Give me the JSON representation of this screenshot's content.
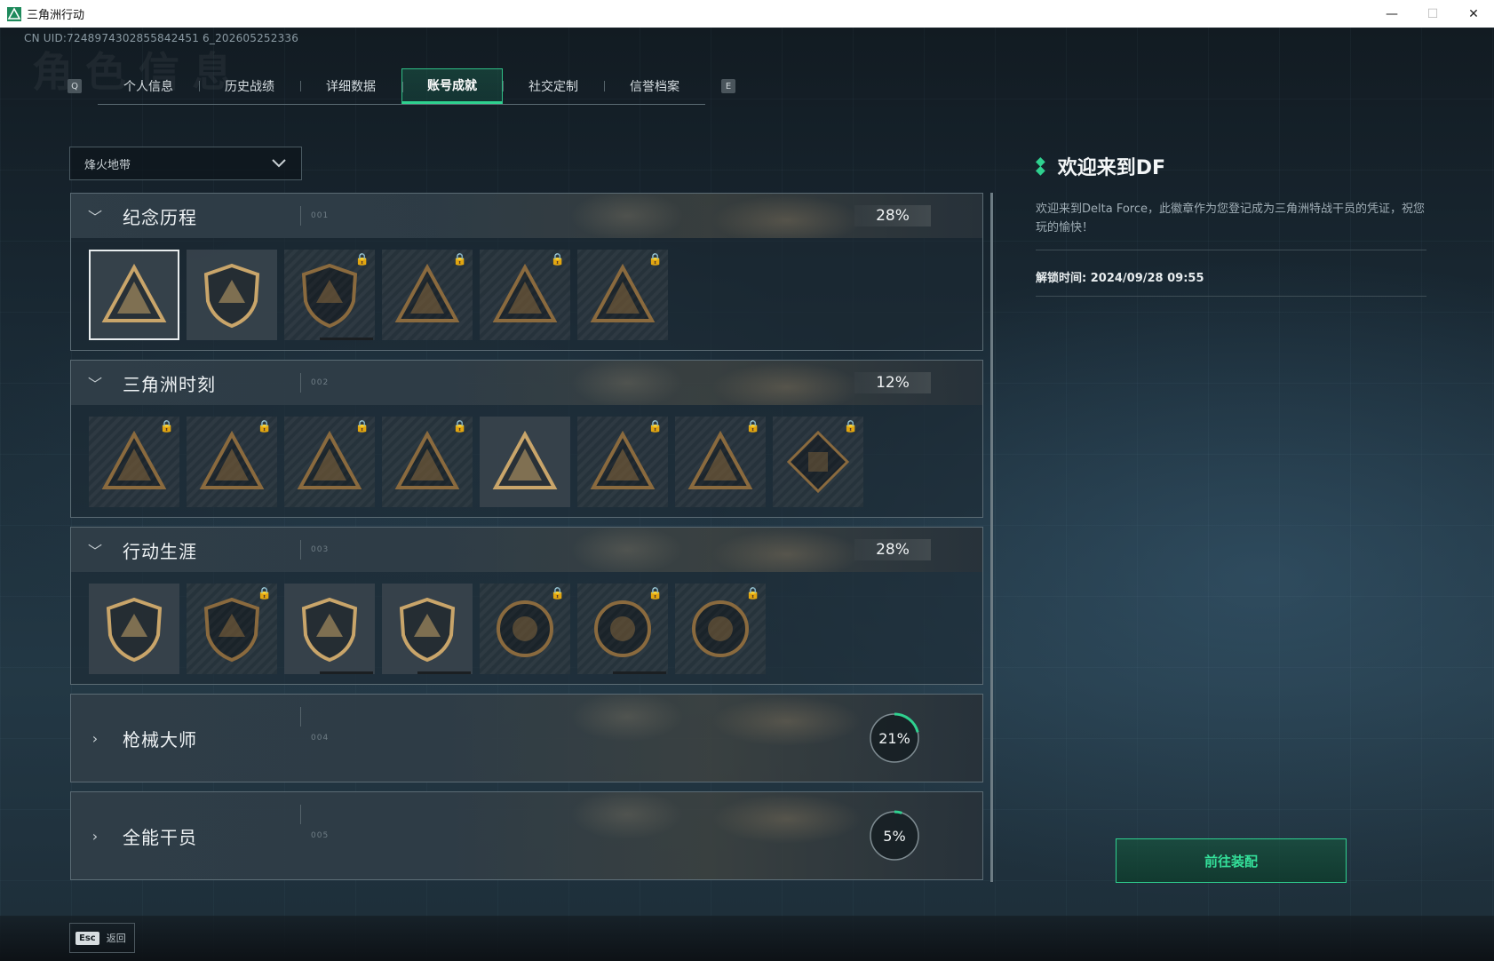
{
  "window": {
    "title": "三角洲行动",
    "minimize": "—",
    "maximize": "☐",
    "close": "✕"
  },
  "uid": "CN UID:7248974302855842451 6_202605252336",
  "watermark": "角色信息",
  "tabs": {
    "left_key": "Q",
    "right_key": "E",
    "items": [
      {
        "label": "个人信息",
        "active": false
      },
      {
        "label": "历史战绩",
        "active": false
      },
      {
        "label": "详细数据",
        "active": false
      },
      {
        "label": "账号成就",
        "active": true
      },
      {
        "label": "社交定制",
        "active": false
      },
      {
        "label": "信誉档案",
        "active": false
      }
    ]
  },
  "mode_select": {
    "value": "烽火地带"
  },
  "sections": [
    {
      "title": "纪念历程",
      "id_text": "001",
      "percent": "28%",
      "expanded": true,
      "badges": [
        {
          "icon": "delta-triangle-badge-icon",
          "locked": false,
          "selected": true
        },
        {
          "icon": "helicopter-badge-icon",
          "locked": false
        },
        {
          "icon": "shield-emblem-badge-icon",
          "locked": true,
          "progress": true
        },
        {
          "icon": "soldier-cross-badge-icon",
          "locked": true
        },
        {
          "icon": "hooded-figure-badge-icon",
          "locked": true
        },
        {
          "icon": "skull-swords-badge-icon",
          "locked": true
        }
      ]
    },
    {
      "title": "三角洲时刻",
      "id_text": "002",
      "percent": "12%",
      "expanded": true,
      "badges": [
        {
          "icon": "robot-triangle-badge-icon",
          "locked": true
        },
        {
          "icon": "operator-triangle-badge-icon",
          "locked": true
        },
        {
          "icon": "kneeling-soldier-badge-icon",
          "locked": true
        },
        {
          "icon": "lion-triangle-badge-icon",
          "locked": true
        },
        {
          "icon": "squad-triangle-badge-icon",
          "locked": false
        },
        {
          "icon": "wolf-triangle-badge-icon",
          "locked": true
        },
        {
          "icon": "dragon-triangle-badge-icon",
          "locked": true
        },
        {
          "icon": "cube-diamond-badge-icon",
          "locked": true
        }
      ]
    },
    {
      "title": "行动生涯",
      "id_text": "003",
      "percent": "28%",
      "expanded": true,
      "badges": [
        {
          "icon": "star-medal-badge-icon",
          "locked": false
        },
        {
          "icon": "chevron-shield-badge-icon",
          "locked": true
        },
        {
          "icon": "police-shield-badge-icon",
          "locked": false,
          "progress": true
        },
        {
          "icon": "gem-shield-badge-icon",
          "locked": false,
          "progress": true
        },
        {
          "icon": "shell-circle-badge-icon",
          "locked": true
        },
        {
          "icon": "skull-circle-badge-icon",
          "locked": true,
          "progress": true
        },
        {
          "icon": "eye-circle-badge-icon",
          "locked": true
        }
      ]
    },
    {
      "title": "枪械大师",
      "id_text": "004",
      "percent": "21%",
      "progress": 0.21,
      "expanded": false
    },
    {
      "title": "全能干员",
      "id_text": "005",
      "percent": "5%",
      "progress": 0.05,
      "expanded": false
    }
  ],
  "detail": {
    "title": "欢迎来到DF",
    "description": "欢迎来到Delta Force，此徽章作为您登记成为三角洲特战干员的凭证，祝您玩的愉快！",
    "unlock_time": "解锁时间: 2024/09/28 09:55"
  },
  "equip_button": "前往装配",
  "footer": {
    "esc_key": "Esc",
    "back_label": "返回"
  },
  "colors": {
    "accent": "#2fd18f",
    "badge_gold": "#c9a56a",
    "badge_locked": "#8a6a3e"
  }
}
